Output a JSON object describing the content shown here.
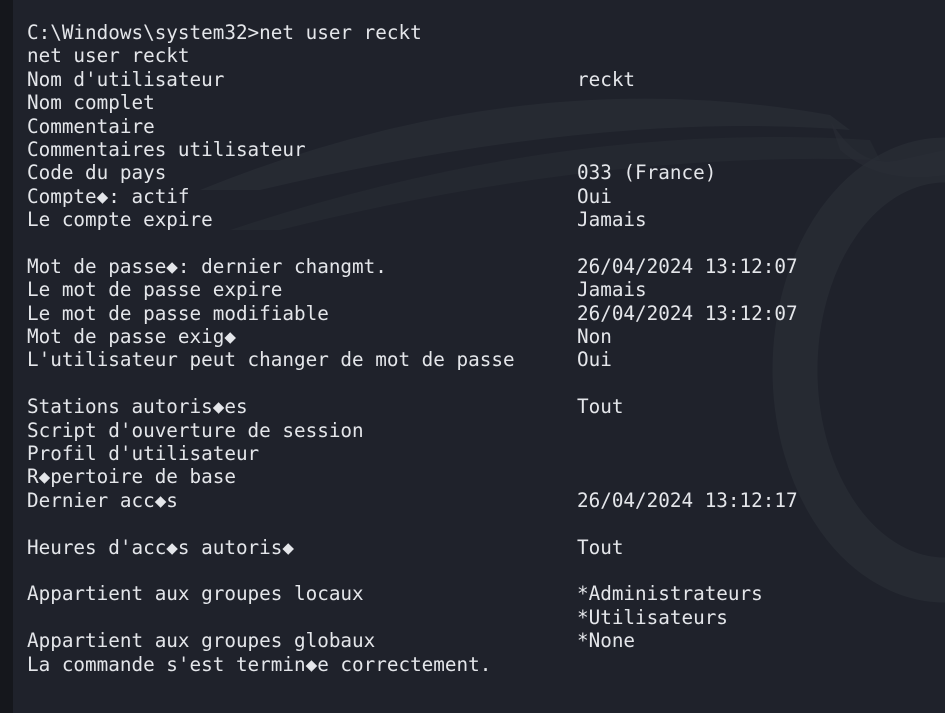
{
  "terminal": {
    "prompt_line": "C:\\Windows\\system32>net user reckt",
    "echo_line": "net user reckt",
    "rows": [
      {
        "label": "Nom d'utilisateur",
        "value": "reckt"
      },
      {
        "label": "Nom complet",
        "value": ""
      },
      {
        "label": "Commentaire",
        "value": ""
      },
      {
        "label": "Commentaires utilisateur",
        "value": ""
      },
      {
        "label": "Code du pays",
        "value": "033 (France)"
      },
      {
        "label": "Compte◆: actif",
        "value": "Oui"
      },
      {
        "label": "Le compte expire",
        "value": "Jamais"
      },
      {
        "label": "",
        "value": ""
      },
      {
        "label": "Mot de passe◆: dernier changmt.",
        "value": "26/04/2024 13:12:07"
      },
      {
        "label": "Le mot de passe expire",
        "value": "Jamais"
      },
      {
        "label": "Le mot de passe modifiable",
        "value": "26/04/2024 13:12:07"
      },
      {
        "label": "Mot de passe exig◆",
        "value": "Non"
      },
      {
        "label": "L'utilisateur peut changer de mot de passe",
        "value": "Oui"
      },
      {
        "label": "",
        "value": ""
      },
      {
        "label": "Stations autoris◆es",
        "value": "Tout"
      },
      {
        "label": "Script d'ouverture de session",
        "value": ""
      },
      {
        "label": "Profil d'utilisateur",
        "value": ""
      },
      {
        "label": "R◆pertoire de base",
        "value": ""
      },
      {
        "label": "Dernier acc◆s",
        "value": "26/04/2024 13:12:17"
      },
      {
        "label": "",
        "value": ""
      },
      {
        "label": "Heures d'acc◆s autoris◆",
        "value": "Tout"
      },
      {
        "label": "",
        "value": ""
      },
      {
        "label": "Appartient aux groupes locaux",
        "value": "*Administrateurs"
      },
      {
        "label": "",
        "value": "*Utilisateurs"
      },
      {
        "label": "Appartient aux groupes globaux",
        "value": "*None"
      }
    ],
    "completion_line": "La commande s'est termin◆e correctement."
  },
  "colors": {
    "background": "#1f222b",
    "text": "#e4e6ea",
    "left_strip": "#15171c"
  }
}
